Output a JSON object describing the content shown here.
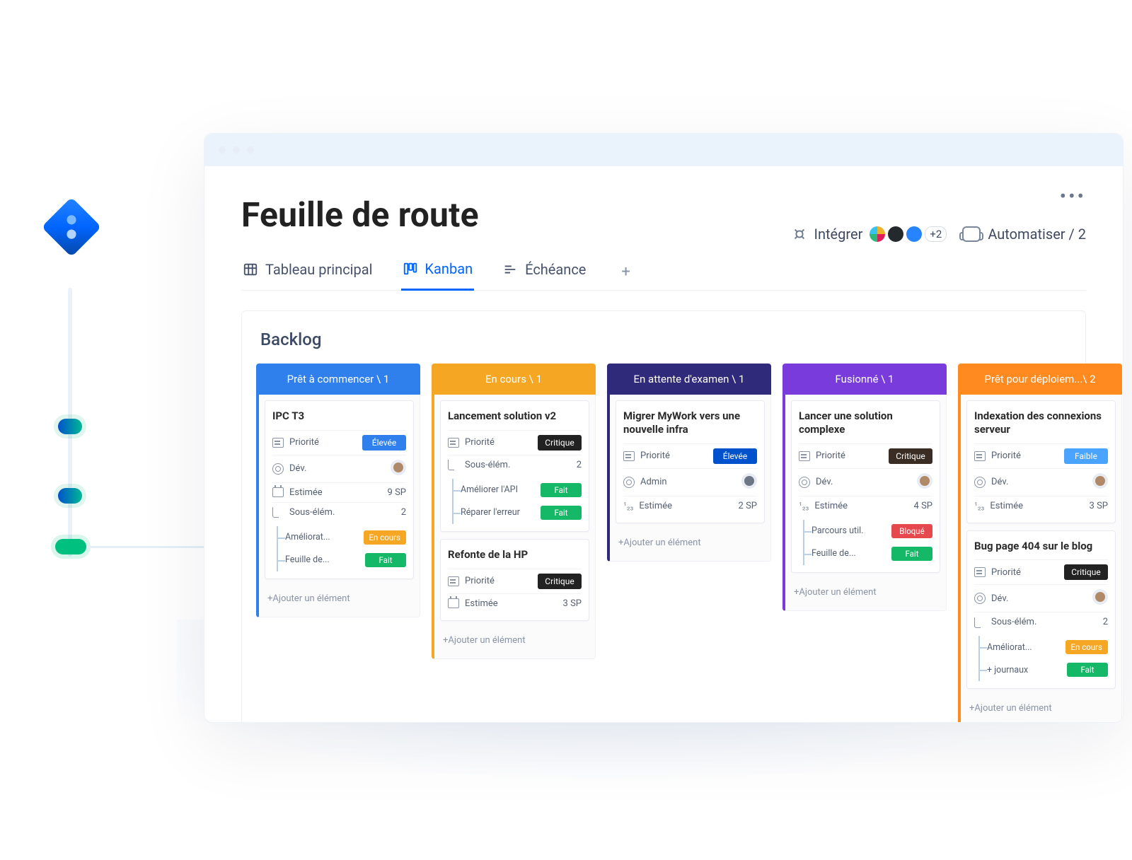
{
  "page": {
    "title": "Feuille de route",
    "more_label": "•••"
  },
  "tabs": {
    "items": [
      {
        "label": "Tableau principal",
        "icon": "table-icon",
        "active": false
      },
      {
        "label": "Kanban",
        "icon": "kanban-icon",
        "active": true
      },
      {
        "label": "Échéance",
        "icon": "deadline-icon",
        "active": false
      }
    ],
    "add_label": "+"
  },
  "actions": {
    "integrate": {
      "label": "Intégrer",
      "extra_badge": "+2"
    },
    "automate": {
      "label": "Automatiser / 2"
    }
  },
  "board": {
    "title": "Backlog",
    "add_item_label": "+Ajouter un élément",
    "field_labels": {
      "priority": "Priorité",
      "dev": "Dév.",
      "admin": "Admin",
      "estimate": "Estimée",
      "subitems": "Sous-élém."
    },
    "columns": [
      {
        "header": "Prêt à commencer \\ 1",
        "color": "blue",
        "cards": [
          {
            "title": "IPC T3",
            "rows": [
              {
                "field": "priority",
                "chip": {
                  "text": "Élevée",
                  "class": "blue"
                }
              },
              {
                "field": "dev",
                "avatar": true
              },
              {
                "field": "estimate",
                "value": "9 SP"
              },
              {
                "field": "subitems",
                "value": "2"
              }
            ],
            "subitems": [
              {
                "name": "Améliorat...",
                "chip": {
                  "text": "En cours",
                  "class": "orange"
                }
              },
              {
                "name": "Feuille de...",
                "chip": {
                  "text": "Fait",
                  "class": "green"
                }
              }
            ]
          }
        ]
      },
      {
        "header": "En cours \\ 1",
        "color": "orange",
        "cards": [
          {
            "title": "Lancement solution v2",
            "rows": [
              {
                "field": "priority",
                "chip": {
                  "text": "Critique",
                  "class": "black"
                }
              },
              {
                "field": "subitems",
                "value": "2"
              }
            ],
            "subitems": [
              {
                "name": "Améliorer l'API",
                "chip": {
                  "text": "Fait",
                  "class": "green"
                }
              },
              {
                "name": "Réparer l'erreur",
                "chip": {
                  "text": "Fait",
                  "class": "green"
                }
              }
            ]
          },
          {
            "title": "Refonte de la HP",
            "rows": [
              {
                "field": "priority",
                "chip": {
                  "text": "Critique",
                  "class": "black"
                }
              },
              {
                "field": "estimate",
                "value": "3 SP",
                "icon": "date"
              }
            ]
          }
        ]
      },
      {
        "header": "En attente d'examen \\ 1",
        "color": "navy",
        "cards": [
          {
            "title": "Migrer MyWork vers une nouvelle infra",
            "rows": [
              {
                "field": "priority",
                "chip": {
                  "text": "Élevée",
                  "class": "dkblue"
                }
              },
              {
                "field": "admin",
                "avatar": true,
                "avatarClass": "alt"
              },
              {
                "field": "estimate",
                "value": "2 SP",
                "icon": "num"
              }
            ]
          }
        ]
      },
      {
        "header": "Fusionné \\ 1",
        "color": "purple",
        "cards": [
          {
            "title": "Lancer une solution complexe",
            "rows": [
              {
                "field": "priority",
                "chip": {
                  "text": "Critique",
                  "class": "darkbrown"
                }
              },
              {
                "field": "dev",
                "avatar": true
              },
              {
                "field": "estimate",
                "value": "4 SP",
                "icon": "num"
              }
            ],
            "subitems": [
              {
                "name": "Parcours util.",
                "chip": {
                  "text": "Bloqué",
                  "class": "red"
                }
              },
              {
                "name": "Feuille de...",
                "chip": {
                  "text": "Fait",
                  "class": "green"
                }
              }
            ]
          }
        ]
      },
      {
        "header": "Prêt pour déploiem...\\ 2",
        "color": "orange2",
        "cards": [
          {
            "title": "Indexation des connexions serveur",
            "rows": [
              {
                "field": "priority",
                "chip": {
                  "text": "Faible",
                  "class": "lightblue"
                }
              },
              {
                "field": "dev",
                "avatar": true
              },
              {
                "field": "estimate",
                "value": "3 SP",
                "icon": "num"
              }
            ]
          },
          {
            "title": "Bug page 404 sur le blog",
            "rows": [
              {
                "field": "priority",
                "chip": {
                  "text": "Critique",
                  "class": "black"
                }
              },
              {
                "field": "dev",
                "avatar": true
              },
              {
                "field": "subitems",
                "value": "2"
              }
            ],
            "subitems": [
              {
                "name": "Améliorat...",
                "chip": {
                  "text": "En cours",
                  "class": "orange"
                }
              },
              {
                "name": "+ journaux",
                "chip": {
                  "text": "Fait",
                  "class": "green"
                }
              }
            ]
          }
        ]
      }
    ]
  },
  "colors": {
    "blue": "#2f80ed",
    "orange": "#f5a623",
    "navy": "#2f2a7a",
    "purple": "#7a3bdc",
    "orange2": "#ff8a1f",
    "chip_green": "#14b866",
    "chip_red": "#e5484d",
    "chip_black": "#222222"
  }
}
